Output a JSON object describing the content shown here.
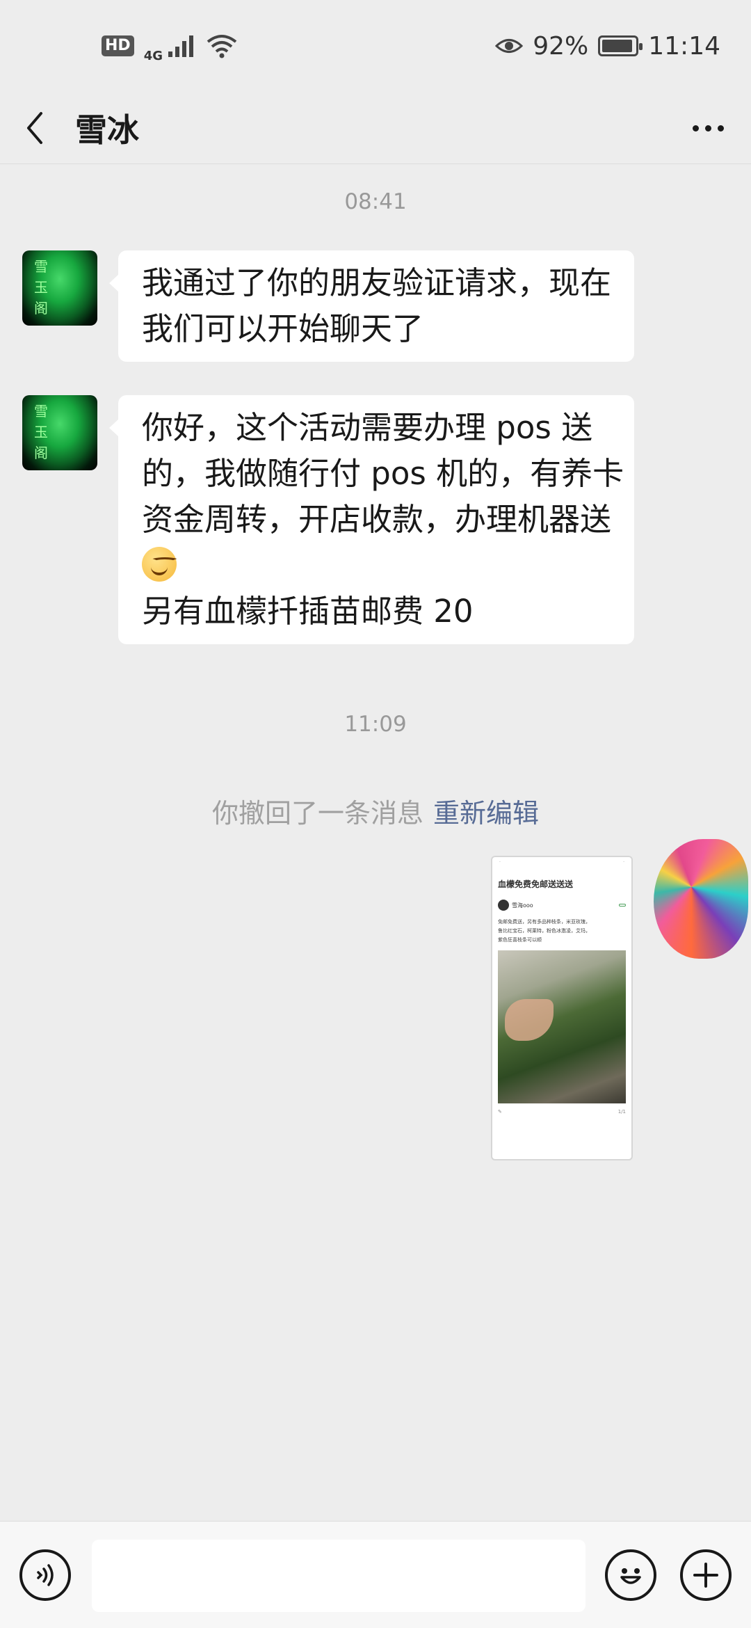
{
  "status_bar": {
    "hd": "HD",
    "network": "4G",
    "battery_percent": "92%",
    "battery_level": 0.92,
    "time": "11:14"
  },
  "header": {
    "title": "雪冰"
  },
  "conversation": {
    "time_1": "08:41",
    "msg_1_lines": [
      "我通过了你的朋友验证请求，现在",
      "我们可以开始聊天了"
    ],
    "msg_2_lines": [
      "你好，这个活动需要办理 pos 送",
      "的，我做随行付 pos 机的，有养卡",
      "资金周转，开店收款，办理机器送",
      "另有血檬扦插苗邮费 20"
    ],
    "avatar_text": [
      "雪",
      "玉",
      "阁"
    ],
    "time_2": "11:09",
    "recall_text": "你撤回了一条消息",
    "recall_edit": "重新编辑"
  },
  "screenshot_thumb": {
    "title": "血檬免费免邮送送送",
    "author": "雪海ooo",
    "body_lines": [
      "免邮免费送，另有多品种枝条，米亚玫瑰，",
      "鲁比红宝石，柯莱特，粉色冰激凌，艾玛，",
      "紫色狂喜枝条可以顺"
    ],
    "page": "1/1"
  },
  "icons": {
    "back": "chevron-left-icon",
    "more": "more-dots-icon",
    "voice": "voice-icon",
    "emoji": "emoji-icon",
    "plus": "plus-icon"
  }
}
